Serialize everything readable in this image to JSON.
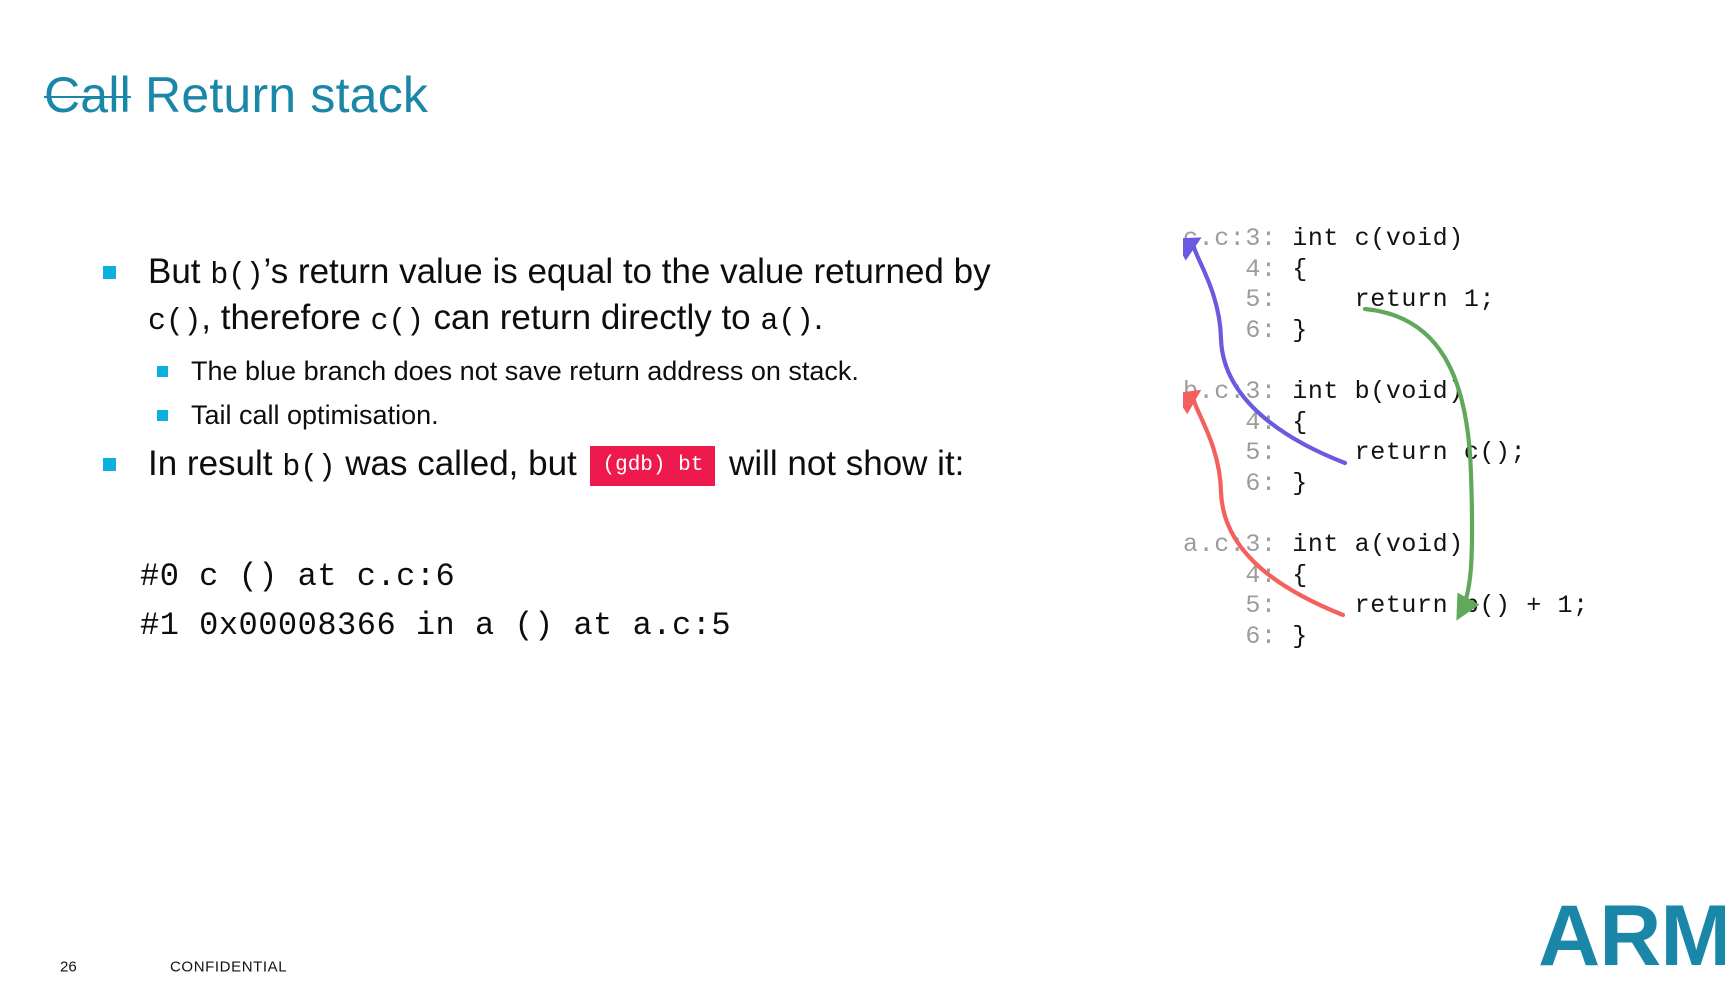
{
  "slide": {
    "title_struck": "Call",
    "title_rest": " Return stack",
    "accent_color": "#1A87A8",
    "bullet_color": "#0BB0DD"
  },
  "bullets": [
    {
      "level": 1,
      "segments": [
        {
          "text": "But ",
          "style": "normal"
        },
        {
          "text": "b()",
          "style": "mono"
        },
        {
          "text": "’s return value is equal to the value returned by ",
          "style": "normal"
        },
        {
          "text": "c()",
          "style": "mono"
        },
        {
          "text": ", therefore ",
          "style": "normal"
        },
        {
          "text": "c()",
          "style": "mono"
        },
        {
          "text": " can return directly to ",
          "style": "normal"
        },
        {
          "text": "a()",
          "style": "mono"
        },
        {
          "text": ".",
          "style": "normal"
        }
      ]
    },
    {
      "level": 2,
      "segments": [
        {
          "text": "The blue branch does not save return address on stack.",
          "style": "normal"
        }
      ]
    },
    {
      "level": 2,
      "segments": [
        {
          "text": "Tail call optimisation.",
          "style": "normal"
        }
      ]
    },
    {
      "level": 1,
      "segments": [
        {
          "text": "In result ",
          "style": "normal"
        },
        {
          "text": "b()",
          "style": "mono"
        },
        {
          "text": " was called, but ",
          "style": "normal"
        },
        {
          "text": "(gdb) bt",
          "style": "badge"
        },
        {
          "text": " will not show it:",
          "style": "normal"
        }
      ]
    }
  ],
  "gdb_output": {
    "badge_label": "(gdb) bt",
    "badge_bg": "#EE1A4E",
    "lines": [
      "#0 c () at c.c:6",
      "#1 0x00008366 in a () at a.c:5"
    ]
  },
  "code_panel": {
    "gutter_color": "#9c9c9c",
    "source_color": "#121212",
    "lines": [
      {
        "gutter": "c.c:3: ",
        "src": "int c(void)"
      },
      {
        "gutter": "    4: ",
        "src": "{"
      },
      {
        "gutter": "    5: ",
        "src": "    return 1;"
      },
      {
        "gutter": "    6: ",
        "src": "}"
      },
      {
        "gutter": "",
        "src": ""
      },
      {
        "gutter": "b.c:3: ",
        "src": "int b(void)"
      },
      {
        "gutter": "    4: ",
        "src": "{"
      },
      {
        "gutter": "    5: ",
        "src": "    return c();"
      },
      {
        "gutter": "    6: ",
        "src": "}"
      },
      {
        "gutter": "",
        "src": ""
      },
      {
        "gutter": "a.c:3: ",
        "src": "int a(void)"
      },
      {
        "gutter": "    4: ",
        "src": "{"
      },
      {
        "gutter": "    5: ",
        "src": "    return b() + 1;"
      },
      {
        "gutter": "    6: ",
        "src": "}"
      }
    ],
    "arrows": [
      {
        "name": "call-a-to-b-arrow",
        "color": "#F4605E",
        "label": "red call arrow from a.c:5 to b.c:3"
      },
      {
        "name": "call-b-to-c-arrow",
        "color": "#6A5AE0",
        "label": "blue call arrow from b.c:5 to c.c:3"
      },
      {
        "name": "return-c-to-a-arrow",
        "color": "#5FA85C",
        "label": "green return arrow from c.c:5 to a.c:5"
      }
    ]
  },
  "footer": {
    "page_number": "26",
    "classification": "CONFIDENTIAL",
    "logo_text": "ARM"
  }
}
